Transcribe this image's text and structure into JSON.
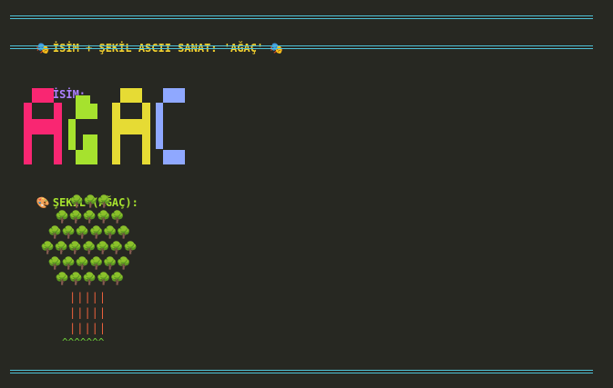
{
  "header": {
    "rule": "═══════════════════════════════════════════════════════════════════",
    "emoji_left": "🎭",
    "title": "İSİM + ŞEKİL ASCII SANAT: 'AĞAÇ'",
    "emoji_right": "🎭"
  },
  "isim": {
    "emoji": "📝",
    "label": "İSİM:",
    "word": "AĞAÇ",
    "colors": {
      "A1": "#f92672",
      "G": "#a6e22e",
      "A2": "#e6db34",
      "C": "#8fa8ff"
    }
  },
  "sekil": {
    "emoji": "🎨",
    "label": "ŞEKİL (AĞAÇ):",
    "canopy_rows": [
      "🌳🌳🌳",
      "🌳🌳🌳🌳🌳",
      "🌳🌳🌳🌳🌳🌳",
      "🌳🌳🌳🌳🌳🌳🌳",
      "🌳🌳🌳🌳🌳🌳",
      "🌳🌳🌳🌳🌳"
    ],
    "trunk_rows": [
      "|||||",
      "|||||",
      "|||||"
    ],
    "ground": "^^^^^^^"
  },
  "footer": {
    "rule": "═══════════════════════════════════════════════════════════════════"
  }
}
